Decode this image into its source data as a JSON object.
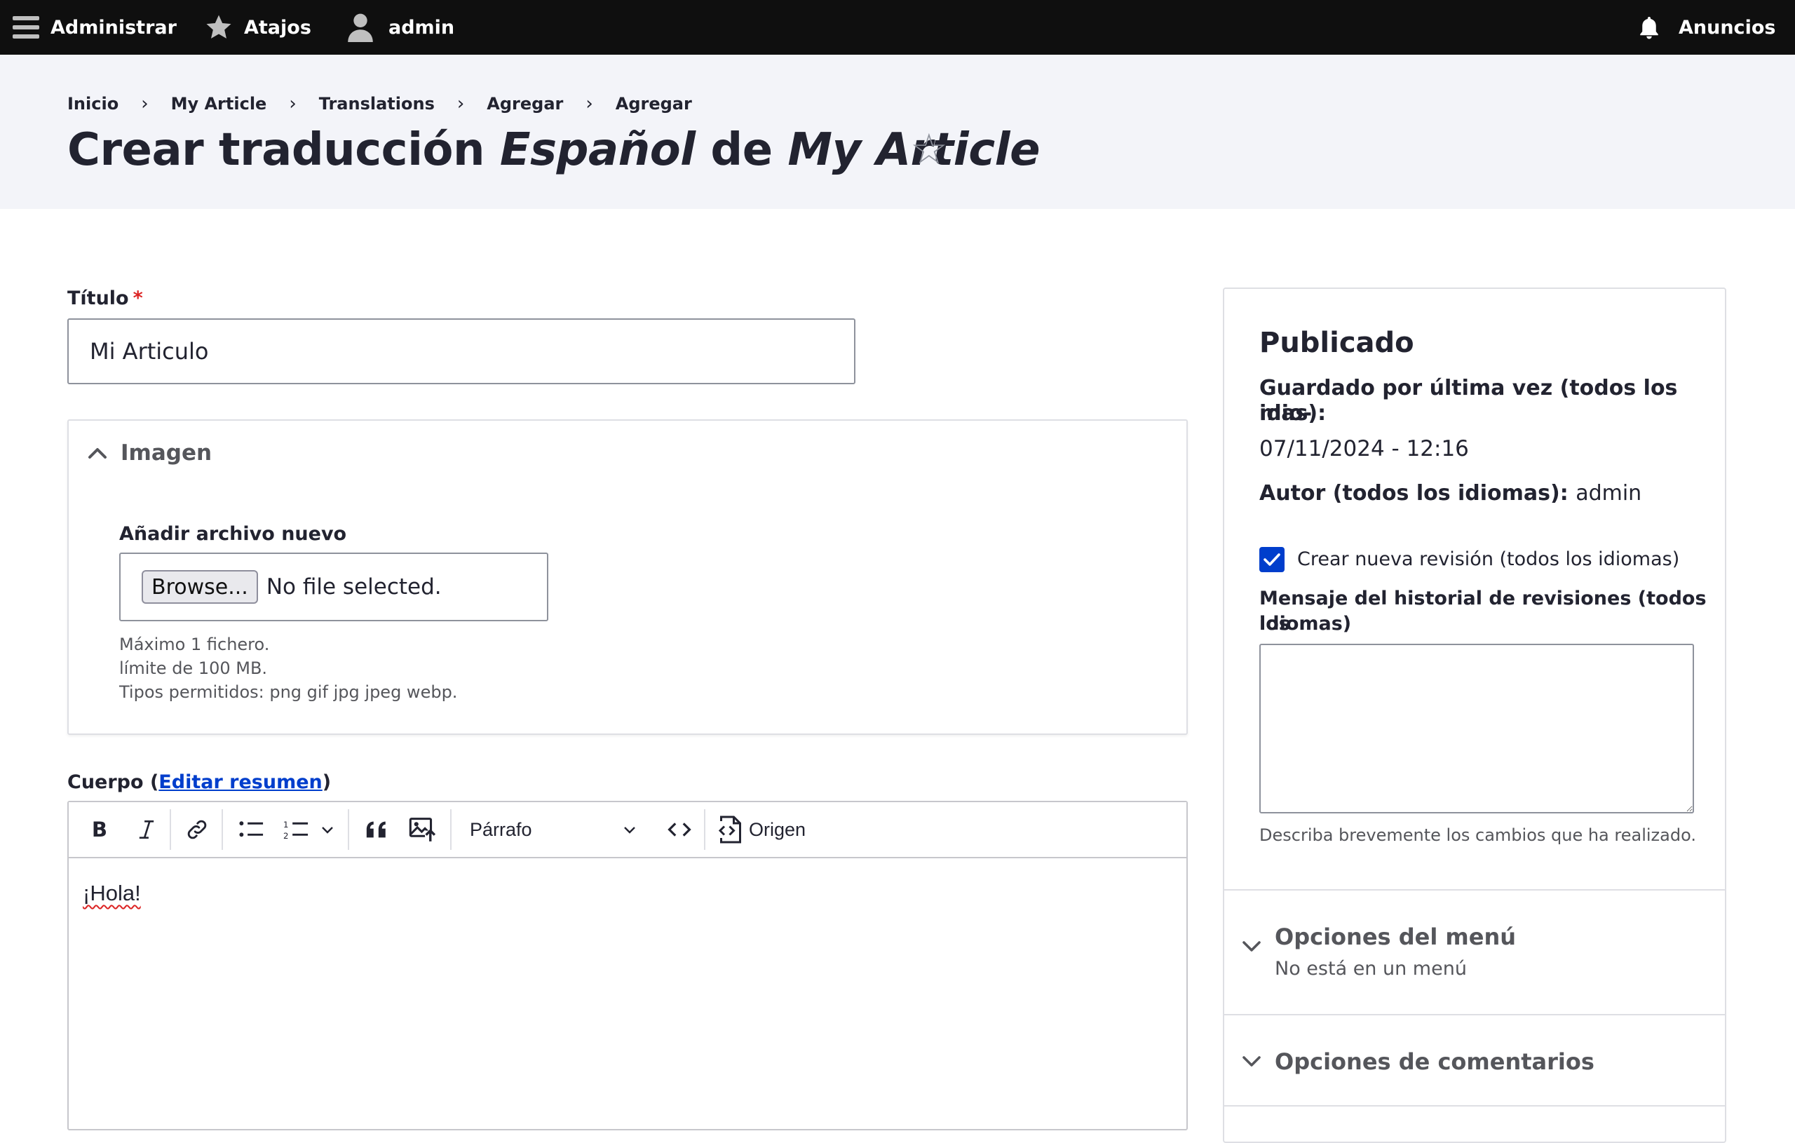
{
  "toolbar": {
    "manage": "Administrar",
    "shortcuts": "Atajos",
    "user": "admin",
    "announcements": "Anuncios"
  },
  "breadcrumb": [
    "Inicio",
    "My Article",
    "Translations",
    "Agregar",
    "Agregar"
  ],
  "page_title": {
    "prefix": "Crear traducción ",
    "language": "Español",
    "middle": " de ",
    "entity": "My Article"
  },
  "title_field": {
    "label": "Título",
    "required": "*",
    "value": "Mi Articulo"
  },
  "image_field": {
    "summary": "Imagen",
    "add_label": "Añadir archivo nuevo",
    "browse": "Browse...",
    "status": "No file selected.",
    "help": [
      "Máximo 1 fichero.",
      "límite de 100 MB.",
      "Tipos permitidos: png gif jpg jpeg webp."
    ]
  },
  "body_field": {
    "label": "Cuerpo",
    "paren_open": "(",
    "edit_summary": "Editar resumen",
    "paren_close": ")",
    "format": "Párrafo",
    "source": "Origen",
    "content": "¡Hola!"
  },
  "sidebar": {
    "status": "Publicado",
    "last_saved_label_1": "Guardado por última vez (todos los idio-",
    "last_saved_label_2": "mas):",
    "last_saved_value": "07/11/2024 - 12:16",
    "author_label": "Autor (todos los idiomas):",
    "author_value": "admin",
    "new_revision": "Crear nueva revisión (todos los idiomas)",
    "revision_log_label_1": "Mensaje del historial de revisiones (todos los",
    "revision_log_label_2": "idiomas)",
    "revision_log_value": "",
    "revision_help": "Describa brevemente los cambios que ha realizado.",
    "menu_options": "Opciones del menú",
    "menu_options_sub": "No está en un menú",
    "comment_options": "Opciones de comentarios"
  },
  "colors": {
    "toolbar_bg": "#0f0f0f",
    "header_bg": "#f3f4f9",
    "accent_blue": "#003ecc",
    "required_red": "#dc2323"
  }
}
